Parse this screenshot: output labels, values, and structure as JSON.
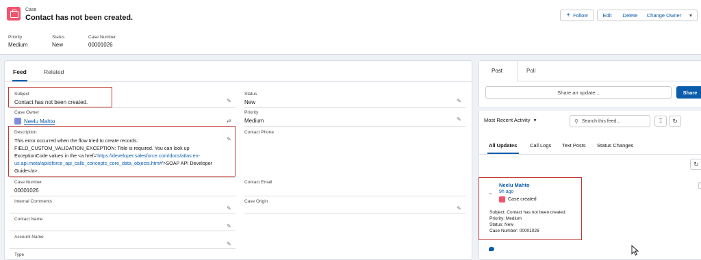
{
  "header": {
    "object_label": "Case",
    "title": "Contact has not been created.",
    "buttons": {
      "follow": "Follow",
      "edit": "Edit",
      "delete": "Delete",
      "change_owner": "Change Owner"
    },
    "fields": [
      {
        "label": "Priority",
        "value": "Medium"
      },
      {
        "label": "Status",
        "value": "New"
      },
      {
        "label": "Case Number",
        "value": "00001026"
      }
    ]
  },
  "tabs": {
    "feed": "Feed",
    "related": "Related"
  },
  "details": {
    "subject": {
      "label": "Subject",
      "value": "Contact has not been created."
    },
    "status": {
      "label": "Status",
      "value": "New"
    },
    "case_owner": {
      "label": "Case Owner",
      "value": "Neelu Mahto"
    },
    "priority": {
      "label": "Priority",
      "value": "Medium"
    },
    "description": {
      "label": "Description",
      "line1": "This error occurred when the flow tried to create records:",
      "line2": "FIELD_CUSTOM_VALIDATION_EXCEPTION: Titile is required. You can look up",
      "line3a": "ExceptionCode values in the <a href='",
      "line3b": "https://developer.salesforce.com/docs/atlas.en-",
      "line4a": "us.api.meta/api/sforce_api_calls_concepts_core_data_objects.htm#",
      "line4b": "'>SOAP API Developer",
      "line5": "Guide</a>."
    },
    "contact_phone": {
      "label": "Contact Phone",
      "value": ""
    },
    "case_number": {
      "label": "Case Number",
      "value": "00001026"
    },
    "contact_email": {
      "label": "Contact Email",
      "value": ""
    },
    "internal_comments": {
      "label": "Internal Comments",
      "value": ""
    },
    "case_origin": {
      "label": "Case Origin",
      "value": ""
    },
    "contact_name": {
      "label": "Contact Name",
      "value": ""
    },
    "account_name": {
      "label": "Account Name",
      "value": ""
    },
    "type": {
      "label": "Type",
      "value": ""
    }
  },
  "publisher": {
    "tabs": {
      "post": "Post",
      "poll": "Poll"
    },
    "share_placeholder": "Share an update...",
    "share_button": "Share"
  },
  "feed": {
    "sort_label": "Most Recent Activity",
    "search_placeholder": "Search this feed...",
    "tabs": [
      "All Updates",
      "Call Logs",
      "Text Posts",
      "Status Changes"
    ],
    "item": {
      "author": "Neelu Mahto",
      "time": "9h ago",
      "event": "Case created",
      "subject": "Subject: Contact has not been created.",
      "priority": "Priority: Medium",
      "status": "Status: New",
      "case_number": "Case Number: 00001026"
    }
  },
  "colors": {
    "brand_blue": "#0b5cab",
    "case_icon": "#f2536d",
    "highlight_red": "#c23934"
  }
}
